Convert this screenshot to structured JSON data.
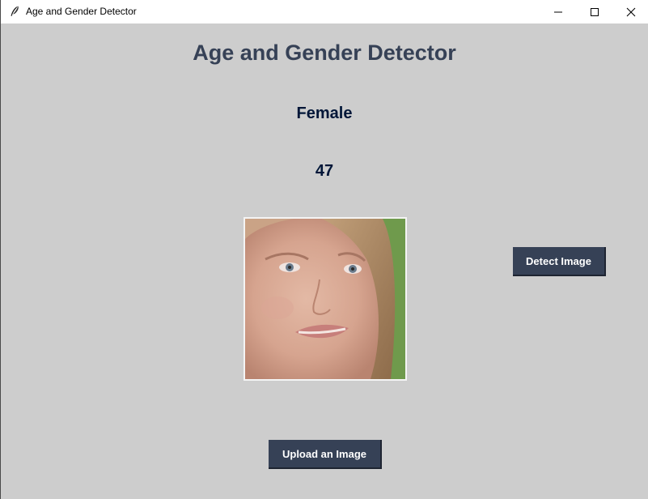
{
  "window": {
    "title": "Age and Gender Detector"
  },
  "main": {
    "heading": "Age and Gender Detector",
    "gender_result": "Female",
    "age_result": "47"
  },
  "buttons": {
    "detect_label": "Detect Image",
    "upload_label": "Upload an Image"
  },
  "colors": {
    "background": "#cdcdcd",
    "heading": "#364156",
    "result_text": "#011638",
    "button_bg": "#364156",
    "button_text": "#ffffff"
  },
  "icons": {
    "app": "feather-icon",
    "minimize": "minimize-icon",
    "maximize": "maximize-icon",
    "close": "close-icon"
  }
}
